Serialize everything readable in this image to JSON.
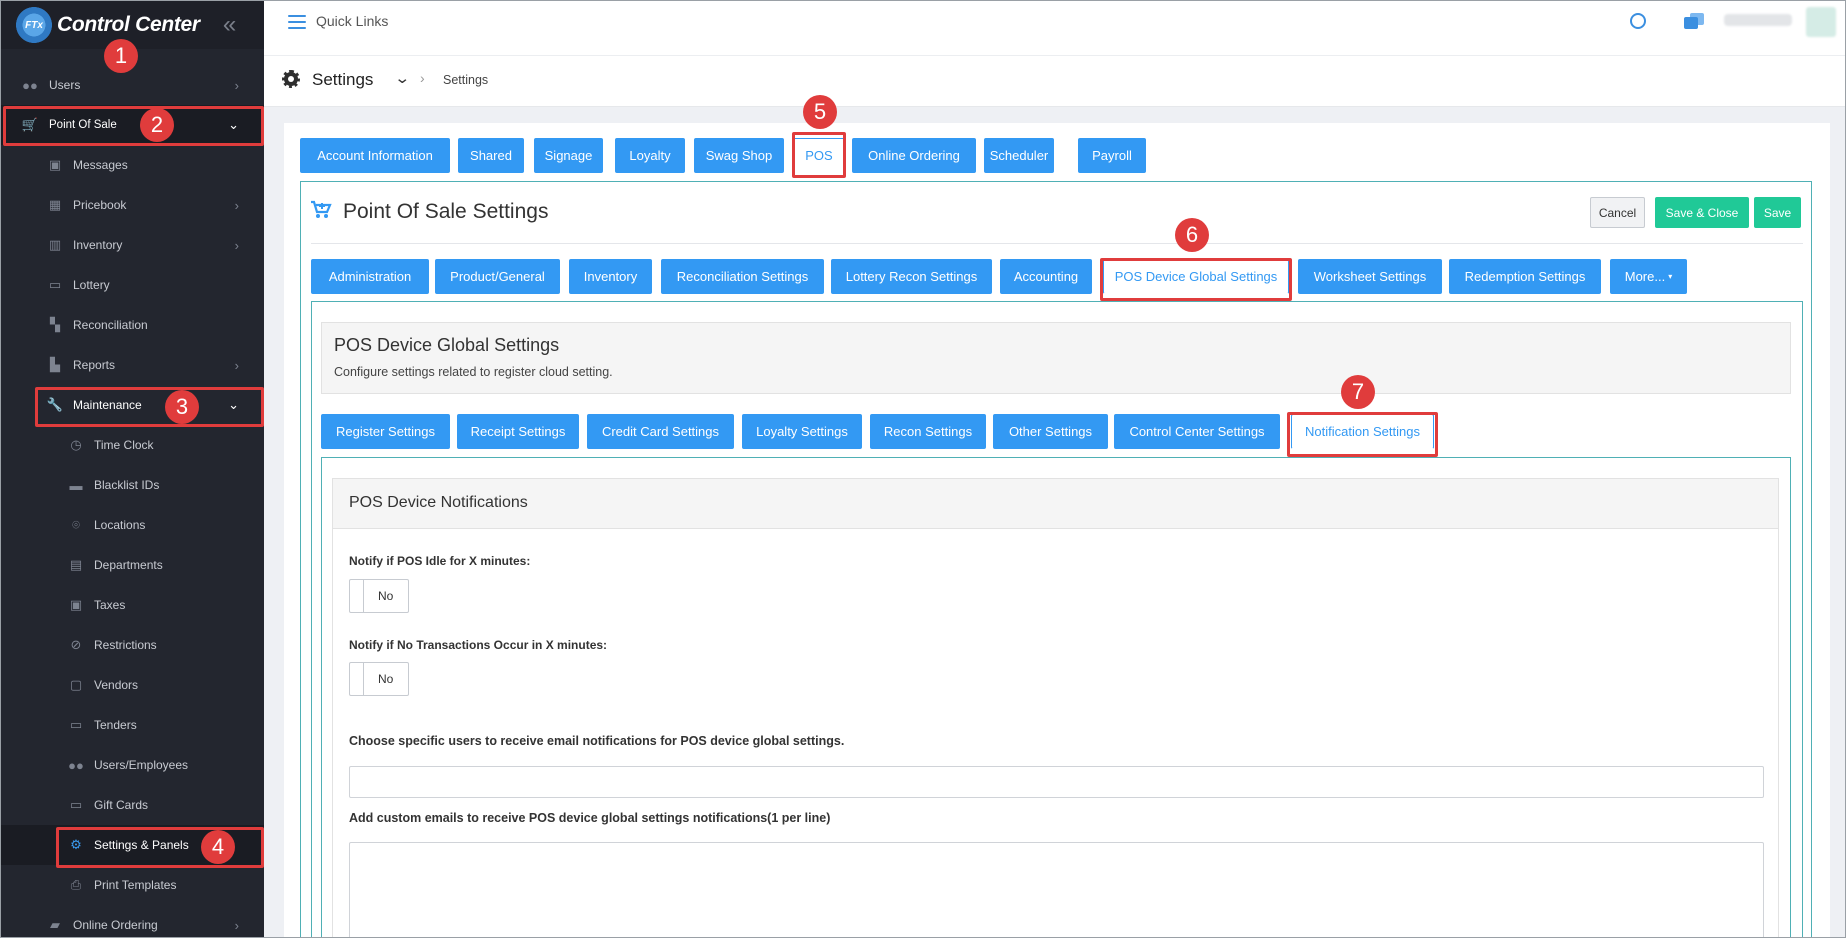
{
  "brand": {
    "logo_text": "FTx",
    "title": "Control Center"
  },
  "sidebar": {
    "items": [
      {
        "label": "Users",
        "icon": "users-icon"
      },
      {
        "label": "Point Of Sale",
        "icon": "cart-icon"
      },
      {
        "label": "Messages",
        "icon": "message-icon"
      },
      {
        "label": "Pricebook",
        "icon": "pricebook-icon"
      },
      {
        "label": "Inventory",
        "icon": "inventory-icon"
      },
      {
        "label": "Lottery",
        "icon": "lottery-icon"
      },
      {
        "label": "Reconciliation",
        "icon": "reconciliation-icon"
      },
      {
        "label": "Reports",
        "icon": "reports-icon"
      },
      {
        "label": "Maintenance",
        "icon": "wrench-icon"
      },
      {
        "label": "Time Clock",
        "icon": "clock-icon"
      },
      {
        "label": "Blacklist IDs",
        "icon": "id-card-icon"
      },
      {
        "label": "Locations",
        "icon": "location-pin-icon"
      },
      {
        "label": "Departments",
        "icon": "departments-icon"
      },
      {
        "label": "Taxes",
        "icon": "taxes-icon"
      },
      {
        "label": "Restrictions",
        "icon": "ban-icon"
      },
      {
        "label": "Vendors",
        "icon": "vendors-icon"
      },
      {
        "label": "Tenders",
        "icon": "tenders-icon"
      },
      {
        "label": "Users/Employees",
        "icon": "users-icon"
      },
      {
        "label": "Gift Cards",
        "icon": "gift-card-icon"
      },
      {
        "label": "Settings & Panels",
        "icon": "gear-icon"
      },
      {
        "label": "Print Templates",
        "icon": "printer-icon"
      },
      {
        "label": "Online Ordering",
        "icon": "bag-icon"
      }
    ]
  },
  "topbar": {
    "quick_links": "Quick Links"
  },
  "page_header": {
    "title": "Settings",
    "breadcrumb": "Settings"
  },
  "top_tabs": [
    "Account Information",
    "Shared",
    "Signage",
    "Loyalty",
    "Swag Shop",
    "POS",
    "Online Ordering",
    "Scheduler",
    "Payroll"
  ],
  "pos_settings": {
    "title": "Point Of Sale Settings",
    "cancel": "Cancel",
    "save_close": "Save & Close",
    "save": "Save"
  },
  "pos_tabs": [
    "Administration",
    "Product/General",
    "Inventory",
    "Reconciliation Settings",
    "Lottery Recon Settings",
    "Accounting",
    "POS Device Global Settings",
    "Worksheet Settings",
    "Redemption Settings",
    "More..."
  ],
  "global_section": {
    "title": "POS Device Global Settings",
    "subtitle": "Configure settings related to register cloud setting."
  },
  "device_tabs": [
    "Register Settings",
    "Receipt Settings",
    "Credit Card Settings",
    "Loyalty Settings",
    "Recon Settings",
    "Other Settings",
    "Control Center Settings",
    "Notification Settings"
  ],
  "notifications": {
    "panel_title": "POS Device Notifications",
    "idle_label": "Notify if POS Idle for X minutes:",
    "idle_value": "No",
    "no_txn_label": "Notify if No Transactions Occur in X minutes:",
    "no_txn_value": "No",
    "users_label": "Choose specific users to receive email notifications for POS device global settings.",
    "emails_label": "Add custom emails to receive POS device global settings notifications(1 per line)"
  },
  "annotations": [
    "1",
    "2",
    "3",
    "4",
    "5",
    "6",
    "7"
  ],
  "colors": {
    "accent": "#3399f3",
    "highlight": "#e03c3c",
    "success": "#20c997",
    "sidebar": "#23262f"
  }
}
